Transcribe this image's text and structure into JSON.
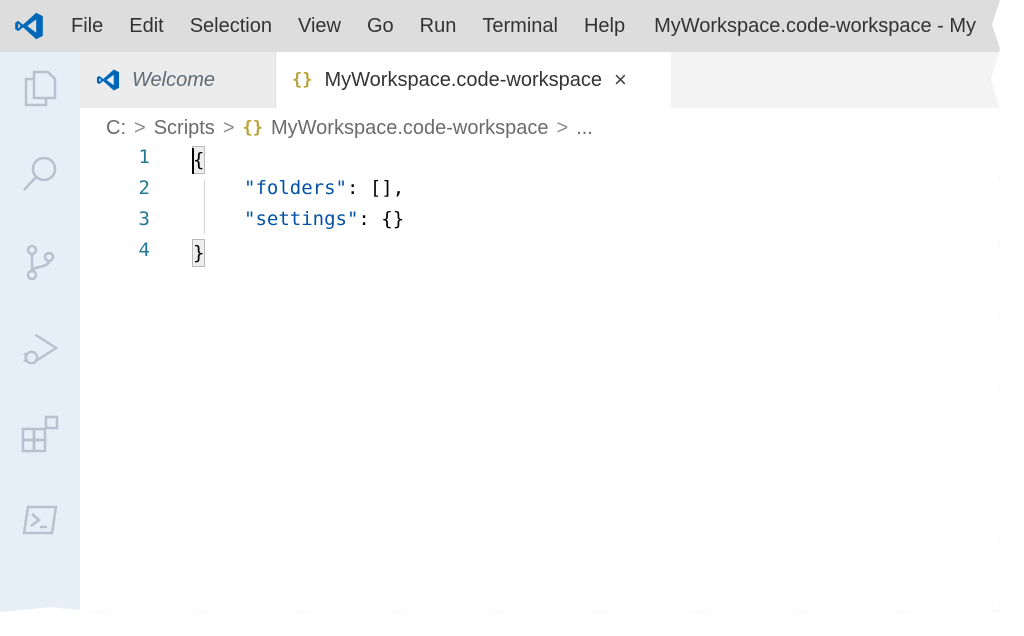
{
  "menubar": {
    "items": [
      "File",
      "Edit",
      "Selection",
      "View",
      "Go",
      "Run",
      "Terminal",
      "Help"
    ],
    "window_title": "MyWorkspace.code-workspace - My"
  },
  "colors": {
    "accent": "#0066b8",
    "activity_bar": "#e6eef8",
    "titlebar": "#dddddd",
    "json_key": "#0451a5",
    "line_number": "#237893"
  },
  "activitybar": {
    "icons": [
      "explorer-icon",
      "search-icon",
      "source-control-icon",
      "run-debug-icon",
      "extensions-icon",
      "powershell-icon"
    ]
  },
  "tabs": [
    {
      "label": "Welcome",
      "icon": "vscode-logo-icon",
      "active": false
    },
    {
      "label": "MyWorkspace.code-workspace",
      "icon": "{}",
      "active": true,
      "close": "×"
    }
  ],
  "breadcrumb": {
    "items": [
      "C:",
      "Scripts",
      "MyWorkspace.code-workspace",
      "..."
    ],
    "file_icon": "{}",
    "separator": ">"
  },
  "editor": {
    "lines": [
      {
        "number": "1",
        "text": "{"
      },
      {
        "number": "2",
        "key": "\"folders\"",
        "rest": ": [],"
      },
      {
        "number": "3",
        "key": "\"settings\"",
        "rest": ": {}"
      },
      {
        "number": "4",
        "text": "}"
      }
    ]
  }
}
